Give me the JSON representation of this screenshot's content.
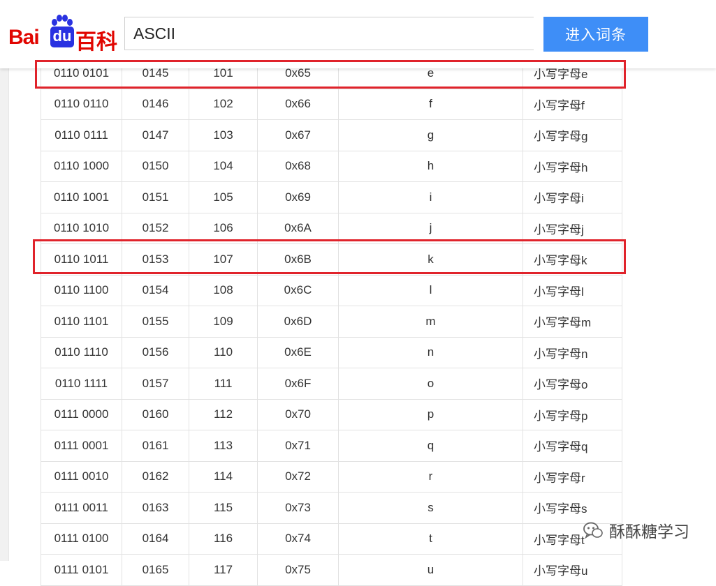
{
  "header": {
    "logo_bai": "Bai",
    "logo_du": "du",
    "logo_baike": "百科",
    "search_value": "ASCII",
    "search_button_label": "进入词条"
  },
  "table": {
    "rows": [
      [
        "0110 0101",
        "0145",
        "101",
        "0x65",
        "e",
        "小写字母e"
      ],
      [
        "0110 0110",
        "0146",
        "102",
        "0x66",
        "f",
        "小写字母f"
      ],
      [
        "0110 0111",
        "0147",
        "103",
        "0x67",
        "g",
        "小写字母g"
      ],
      [
        "0110 1000",
        "0150",
        "104",
        "0x68",
        "h",
        "小写字母h"
      ],
      [
        "0110 1001",
        "0151",
        "105",
        "0x69",
        "i",
        "小写字母i"
      ],
      [
        "0110 1010",
        "0152",
        "106",
        "0x6A",
        "j",
        "小写字母j"
      ],
      [
        "0110 1011",
        "0153",
        "107",
        "0x6B",
        "k",
        "小写字母k"
      ],
      [
        "0110 1100",
        "0154",
        "108",
        "0x6C",
        "l",
        "小写字母l"
      ],
      [
        "0110 1101",
        "0155",
        "109",
        "0x6D",
        "m",
        "小写字母m"
      ],
      [
        "0110 1110",
        "0156",
        "110",
        "0x6E",
        "n",
        "小写字母n"
      ],
      [
        "0110 1111",
        "0157",
        "111",
        "0x6F",
        "o",
        "小写字母o"
      ],
      [
        "0111 0000",
        "0160",
        "112",
        "0x70",
        "p",
        "小写字母p"
      ],
      [
        "0111 0001",
        "0161",
        "113",
        "0x71",
        "q",
        "小写字母q"
      ],
      [
        "0111 0010",
        "0162",
        "114",
        "0x72",
        "r",
        "小写字母r"
      ],
      [
        "0111 0011",
        "0163",
        "115",
        "0x73",
        "s",
        "小写字母s"
      ],
      [
        "0111 0100",
        "0164",
        "116",
        "0x74",
        "t",
        "小写字母t"
      ],
      [
        "0111 0101",
        "0165",
        "117",
        "0x75",
        "u",
        "小写字母u"
      ]
    ]
  },
  "watermark": {
    "text": "酥酥糖学习",
    "icon": "wechat-icon"
  },
  "colors": {
    "brand_red": "#e10601",
    "brand_blue": "#2932e1",
    "button_blue": "#3e8ef7",
    "highlight_red": "#e0232b"
  }
}
